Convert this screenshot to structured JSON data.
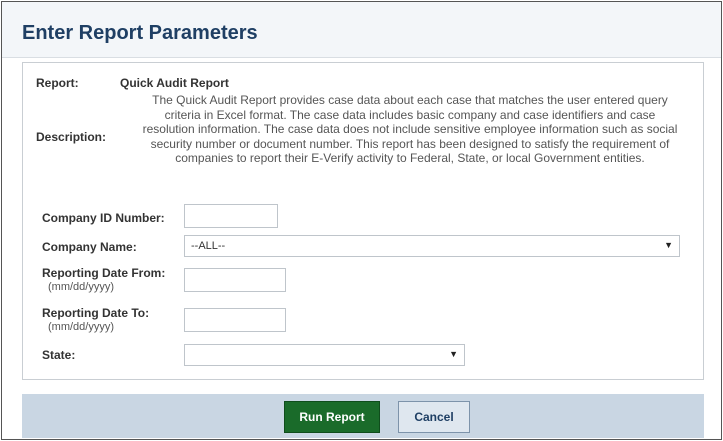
{
  "header": {
    "title": "Enter Report Parameters"
  },
  "report": {
    "label": "Report:",
    "name": "Quick Audit Report",
    "description_label": "Description:",
    "description_lines": [
      "The Quick Audit Report provides case data about each case that matches the user entered query",
      "criteria in Excel format. The case data includes basic company and case identifiers and case",
      "resolution information. The case data does not include sensitive employee information such as social",
      "security number or document number. This report has been designed to satisfy the requirement of",
      "companies to report their E-Verify activity to Federal, State, or local Government entities."
    ]
  },
  "form": {
    "company_id": {
      "label": "Company ID Number:",
      "value": ""
    },
    "company_name": {
      "label": "Company Name:",
      "selected": "--ALL--"
    },
    "date_from": {
      "label": "Reporting Date From:",
      "hint": "(mm/dd/yyyy)",
      "value": ""
    },
    "date_to": {
      "label": "Reporting Date To:",
      "hint": "(mm/dd/yyyy)",
      "value": ""
    },
    "state": {
      "label": "State:",
      "selected": ""
    }
  },
  "buttons": {
    "run": "Run Report",
    "cancel": "Cancel"
  },
  "colors": {
    "title": "#1f3f64",
    "run_button": "#1a6b2a",
    "footer": "#c9d6e3"
  },
  "icons": {
    "dropdown": "chevron-down-icon"
  }
}
